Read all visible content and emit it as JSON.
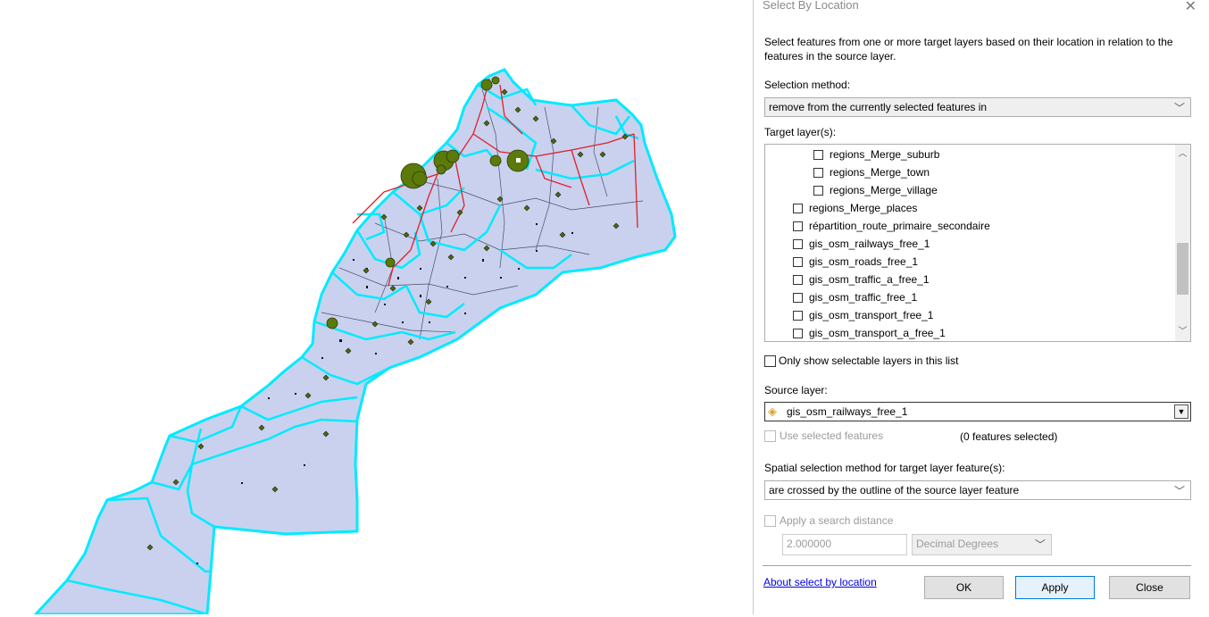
{
  "dialog": {
    "title": "Select By Location",
    "close_glyph": "✕",
    "description": "Select features from one or more target layers based on their location in relation to the features in the source layer.",
    "selection_method_label": "Selection method:",
    "selection_method_value": "remove from the currently selected features in",
    "target_layers_label": "Target layer(s):",
    "target_layers": [
      {
        "label": "regions_Merge_suburb",
        "checked": false,
        "indent": 2
      },
      {
        "label": "regions_Merge_town",
        "checked": false,
        "indent": 2
      },
      {
        "label": "regions_Merge_village",
        "checked": false,
        "indent": 2
      },
      {
        "label": "regions_Merge_places",
        "checked": false,
        "indent": 1
      },
      {
        "label": "répartition_route_primaire_secondaire",
        "checked": false,
        "indent": 1
      },
      {
        "label": "gis_osm_railways_free_1",
        "checked": false,
        "indent": 1
      },
      {
        "label": "gis_osm_roads_free_1",
        "checked": false,
        "indent": 1
      },
      {
        "label": "gis_osm_traffic_a_free_1",
        "checked": false,
        "indent": 1
      },
      {
        "label": "gis_osm_traffic_free_1",
        "checked": false,
        "indent": 1
      },
      {
        "label": "gis_osm_transport_free_1",
        "checked": false,
        "indent": 1
      },
      {
        "label": "gis_osm_transport_a_free_1",
        "checked": false,
        "indent": 1
      }
    ],
    "only_selectable_label": "Only show selectable layers in this list",
    "source_layer_label": "Source layer:",
    "source_layer_value": "gis_osm_railways_free_1",
    "use_selected_label": "Use selected features",
    "features_selected": "(0 features selected)",
    "spatial_method_label": "Spatial selection method for target layer feature(s):",
    "spatial_method_value": "are crossed by the outline of the source layer feature",
    "apply_distance_label": "Apply a search distance",
    "distance_value": "2.000000",
    "distance_unit": "Decimal Degrees",
    "about_link": "About select by location",
    "ok_label": "OK",
    "apply_label": "Apply",
    "close_label": "Close"
  },
  "map": {
    "region_fill": "#c9d1ee",
    "region_outline": "#00eaff",
    "road_color": "#e0202a",
    "point_color": "#4d6a00"
  }
}
